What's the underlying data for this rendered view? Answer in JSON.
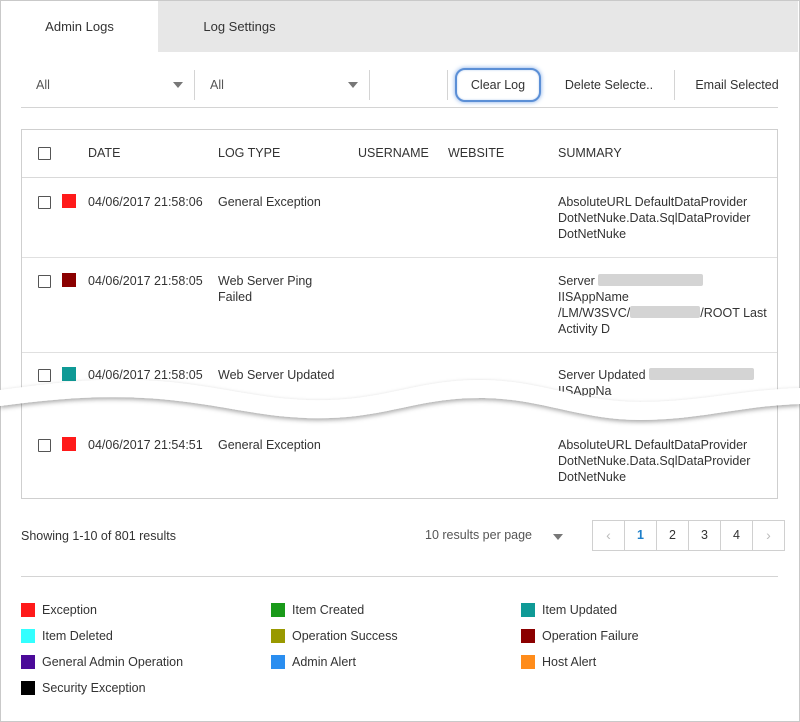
{
  "tabs": [
    {
      "label": "Admin Logs",
      "active": true
    },
    {
      "label": "Log Settings",
      "active": false
    }
  ],
  "toolbar": {
    "filter_type": "All",
    "filter_site": "All",
    "clear_label": "Clear Log",
    "delete_label": "Delete Selecte..",
    "email_label": "Email Selected"
  },
  "table": {
    "headers": {
      "date": "DATE",
      "log_type": "LOG TYPE",
      "username": "USERNAME",
      "website": "WEBSITE",
      "summary": "SUMMARY"
    },
    "rows": [
      {
        "date": "04/06/2017 21:58:06",
        "type": "General Exception",
        "color": "#ff1a1a",
        "summary": [
          "AbsoluteURL DefaultDataProvider",
          "DotNetNuke.Data.SqlDataProvider",
          "DotNetNuke"
        ]
      },
      {
        "date": "04/06/2017 21:58:05",
        "type": [
          "Web Server Ping",
          "Failed"
        ],
        "color": "#8b0000",
        "summary": [
          "Server",
          "IISAppName",
          "/LM/W3SVC/",
          "/ROOT Last",
          "Activity D"
        ]
      },
      {
        "date": "04/06/2017 21:58:05",
        "type": "Web Server Updated",
        "color": "#0f9a96",
        "summary": [
          "Server Updated",
          "IISAppNa"
        ]
      },
      {
        "date": "04/06/2017 21:54:51",
        "type": "General Exception",
        "color": "#ff1a1a",
        "summary": [
          "AbsoluteURL DefaultDataProvider",
          "DotNetNuke.Data.SqlDataProvider",
          "DotNetNuke"
        ]
      }
    ]
  },
  "footer": {
    "showing": "Showing 1-10 of 801 results",
    "per_page": "10 results per page",
    "pages": [
      "1",
      "2",
      "3",
      "4"
    ],
    "active_page": "1",
    "prev_glyph": "‹",
    "next_glyph": "›"
  },
  "legend": [
    {
      "label": "Exception",
      "color": "#ff1a1a"
    },
    {
      "label": "Item Created",
      "color": "#1a9a1a"
    },
    {
      "label": "Item Updated",
      "color": "#0f9a96"
    },
    {
      "label": "Item Deleted",
      "color": "#33ffff"
    },
    {
      "label": "Operation Success",
      "color": "#999900"
    },
    {
      "label": "Operation Failure",
      "color": "#8b0000"
    },
    {
      "label": "General Admin Operation",
      "color": "#4b0a99"
    },
    {
      "label": "Admin Alert",
      "color": "#2a8ef0"
    },
    {
      "label": "Host Alert",
      "color": "#ff8c1a"
    },
    {
      "label": "Security Exception",
      "color": "#000000"
    }
  ]
}
